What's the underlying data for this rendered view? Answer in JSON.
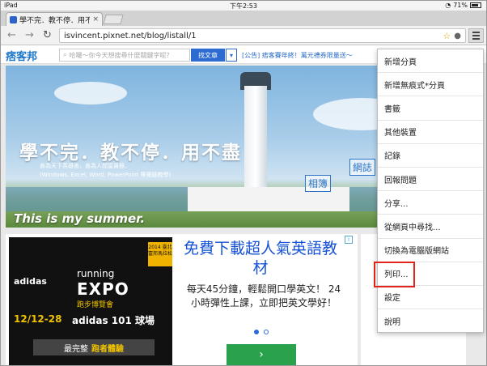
{
  "status": {
    "device": "iPad",
    "time": "下午2:53",
    "battery": "71%"
  },
  "tab": {
    "title": "學不完．教不停．用不盡",
    "close": "×"
  },
  "toolbar": {
    "url": "isvincent.pixnet.net/blog/listall/1"
  },
  "pixnet": {
    "logo": "痞客邦",
    "search_placeholder": "哈囉～你今天想搜尋什麼關鍵字呢？",
    "find_button": "找文章",
    "announcement": "[公告] 痞客賽年終！萬元禮券限量送～"
  },
  "banner": {
    "title": "學不完．教不停．用不盡",
    "sub1": "善為天下英雄善，善為人間富貴極．",
    "sub2": "(Windows, Excel, Word, PowerPoint 等電腦教學)",
    "footer": "This is my summer.",
    "stamp1": "網誌",
    "stamp2": "相簿"
  },
  "ad": {
    "brand": "adidas",
    "running": "running",
    "expo": "EXPO",
    "expo_sub": "跑步博覽會",
    "year_badge": "2014 臺北富邦馬拉松",
    "dates": "12/12-28",
    "venue": "adidas 101 球場",
    "experience_prefix": "最完整",
    "experience_highlight": "跑者體驗",
    "title": "免費下載超人氣英語教材",
    "desc": "每天45分鐘，輕鬆開口學英文！ 24小時彈性上課，立即把英文學好！",
    "go": "›",
    "ad_icon": "i"
  },
  "menu": {
    "items": [
      "新增分頁",
      "新增無痕式*分頁",
      "書籤",
      "其他裝置",
      "記錄",
      "回報問題",
      "分享...",
      "從網頁中尋找...",
      "切換為電腦版網站",
      "列印...",
      "設定",
      "說明"
    ]
  },
  "colors": {
    "accent": "#2e6bd1",
    "highlight": "#e2231a",
    "ad_green": "#2aa24b"
  }
}
